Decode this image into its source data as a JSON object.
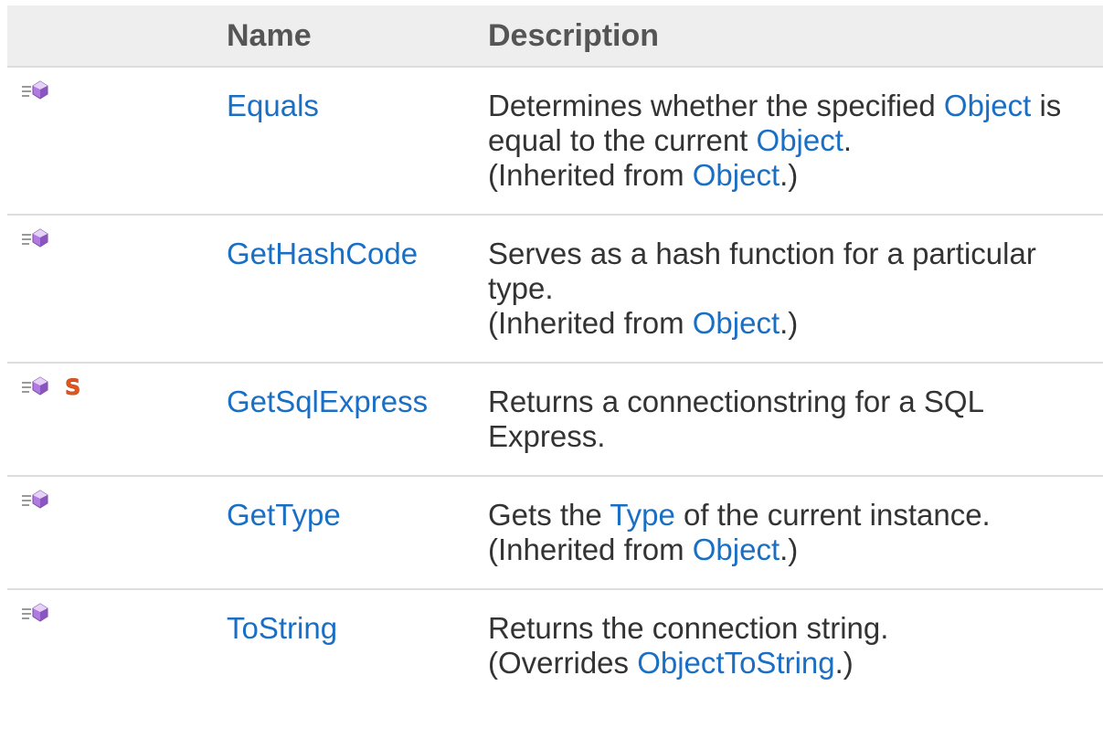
{
  "columns": {
    "icon": "",
    "name": "Name",
    "description": "Description"
  },
  "rows": [
    {
      "name": "Equals",
      "static": false,
      "desc": {
        "before": "Determines whether the specified ",
        "link1": "Object",
        "mid": " is equal to the current ",
        "link2": "Object",
        "after": "."
      },
      "note": {
        "prefix": "(Inherited from ",
        "link": "Object",
        "suffix": ".)"
      }
    },
    {
      "name": "GetHashCode",
      "static": false,
      "desc": {
        "text": "Serves as a hash function for a particular type."
      },
      "note": {
        "prefix": "(Inherited from ",
        "link": "Object",
        "suffix": ".)"
      }
    },
    {
      "name": "GetSqlExpress",
      "static": true,
      "desc": {
        "text": "Returns a connectionstring for a SQL Express."
      }
    },
    {
      "name": "GetType",
      "static": false,
      "desc": {
        "before": "Gets the ",
        "link": "Type",
        "after": " of the current instance."
      },
      "note": {
        "prefix": "(Inherited from ",
        "link": "Object",
        "suffix": ".)"
      }
    },
    {
      "name": "ToString",
      "static": false,
      "desc": {
        "text": "Returns the connection string."
      },
      "note": {
        "prefix": "(Overrides ",
        "link": "ObjectToString",
        "suffix": ".)"
      }
    }
  ],
  "icons": {
    "method": "public-method-icon",
    "static": "static-member-icon"
  },
  "colors": {
    "link": "#1a6fc4",
    "header_bg": "#eeeeee",
    "static_s": "#e2561b",
    "method_cube": "#a56ad6"
  }
}
